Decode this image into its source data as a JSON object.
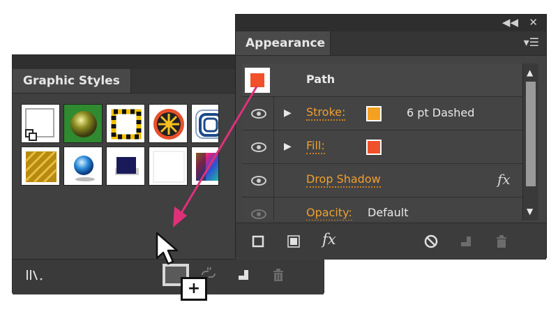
{
  "graphic_styles": {
    "tab_label": "Graphic Styles",
    "swatches": [
      "default-style",
      "green-sphere-style",
      "dashed-border-style",
      "sunburst-style",
      "concentric-style",
      "gold-texture-style",
      "blue-sphere-style",
      "navy-square-style",
      "blank-style",
      "rainbow-style"
    ]
  },
  "appearance": {
    "tab_label": "Appearance",
    "header_label": "Path",
    "rows": [
      {
        "label": "Stroke:",
        "color": "#f5a020",
        "value": "6 pt Dashed"
      },
      {
        "label": "Fill:",
        "color": "#f0502a",
        "value": ""
      },
      {
        "label": "Drop Shadow",
        "fx": "fx"
      },
      {
        "label": "Opacity:",
        "value": "Default"
      }
    ],
    "bottom_fx": "fx"
  },
  "colors": {
    "orange_link": "#f0a030",
    "arrow": "#e0307a"
  },
  "cursor_badge": "+"
}
